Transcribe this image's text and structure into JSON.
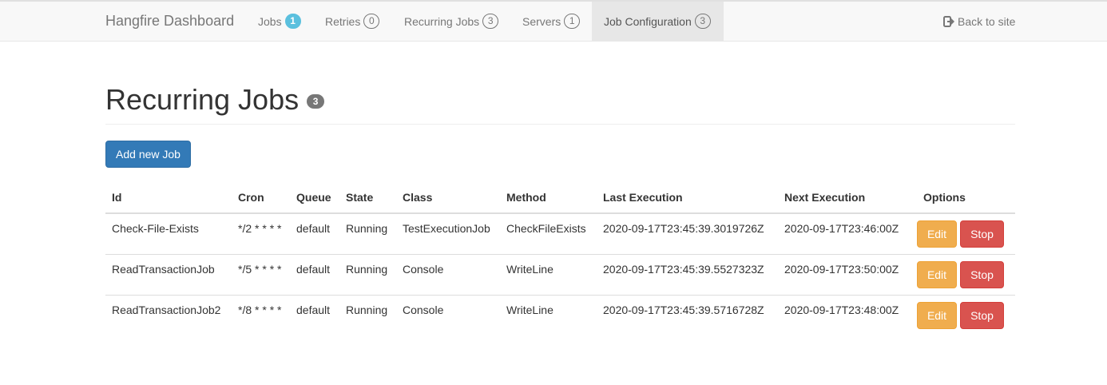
{
  "navbar": {
    "brand": "Hangfire Dashboard",
    "items": [
      {
        "label": "Jobs",
        "count": "1"
      },
      {
        "label": "Retries",
        "count": "0"
      },
      {
        "label": "Recurring Jobs",
        "count": "3"
      },
      {
        "label": "Servers",
        "count": "1"
      },
      {
        "label": "Job Configuration",
        "count": "3"
      }
    ],
    "back_link": "Back to site"
  },
  "page": {
    "title": "Recurring Jobs",
    "count": "3",
    "add_button": "Add new Job"
  },
  "table": {
    "headers": [
      "Id",
      "Cron",
      "Queue",
      "State",
      "Class",
      "Method",
      "Last Execution",
      "Next Execution",
      "Options"
    ],
    "rows": [
      {
        "id": "Check-File-Exists",
        "cron": "*/2 * * * *",
        "queue": "default",
        "state": "Running",
        "class": "TestExecutionJob",
        "method": "CheckFileExists",
        "last": "2020-09-17T23:45:39.3019726Z",
        "next": "2020-09-17T23:46:00Z"
      },
      {
        "id": "ReadTransactionJob",
        "cron": "*/5 * * * *",
        "queue": "default",
        "state": "Running",
        "class": "Console",
        "method": "WriteLine",
        "last": "2020-09-17T23:45:39.5527323Z",
        "next": "2020-09-17T23:50:00Z"
      },
      {
        "id": "ReadTransactionJob2",
        "cron": "*/8 * * * *",
        "queue": "default",
        "state": "Running",
        "class": "Console",
        "method": "WriteLine",
        "last": "2020-09-17T23:45:39.5716728Z",
        "next": "2020-09-17T23:48:00Z"
      }
    ],
    "edit_label": "Edit",
    "stop_label": "Stop"
  },
  "icons": {
    "back": "sign-out-icon"
  },
  "colors": {
    "primary": "#337ab7",
    "warning": "#f0ad4e",
    "danger": "#d9534f",
    "info": "#5bc0de"
  }
}
